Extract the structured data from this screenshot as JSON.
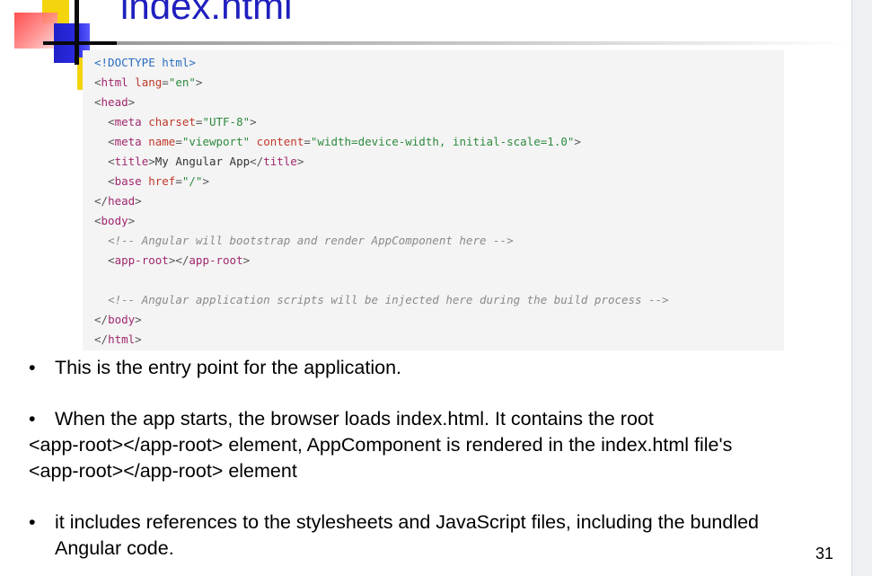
{
  "slide": {
    "title": "index.html",
    "page_number": "31"
  },
  "code": {
    "lines": [
      "<!DOCTYPE html>",
      "<html lang=\"en\">",
      "<head>",
      "  <meta charset=\"UTF-8\">",
      "  <meta name=\"viewport\" content=\"width=device-width, initial-scale=1.0\">",
      "  <title>My Angular App</title>",
      "  <base href=\"/\">",
      "</head>",
      "<body>",
      "  <!-- Angular will bootstrap and render AppComponent here -->",
      "  <app-root></app-root>",
      "",
      "  <!-- Angular application scripts will be injected here during the build process -->",
      "</body>",
      "</html>"
    ]
  },
  "bullets": [
    {
      "marker": "•",
      "lines": [
        "This is the entry point for the application."
      ]
    },
    {
      "marker": "•",
      "lines": [
        "When the app starts, the browser loads index.html. It contains the root",
        "<app-root></app-root> element, AppComponent is rendered in the index.html file's",
        "<app-root></app-root> element"
      ]
    },
    {
      "marker": "•",
      "lines": [
        "it includes references to the stylesheets and JavaScript files, including the bundled",
        "Angular code."
      ]
    }
  ],
  "colors": {
    "title": "#1f1fbf",
    "code_background": "#f4f4f4",
    "tag": "#a0286e",
    "attribute": "#c0392b",
    "string": "#2e8a3e",
    "comment": "#8a8a8a"
  }
}
